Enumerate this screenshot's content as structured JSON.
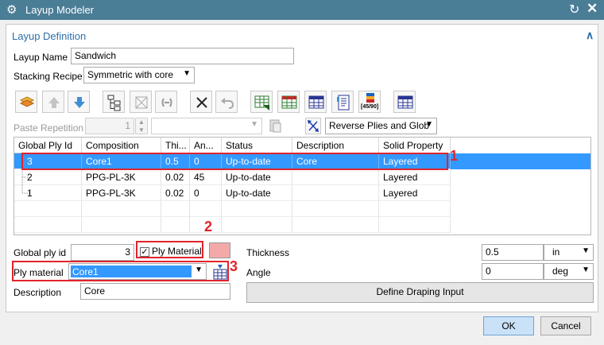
{
  "window": {
    "title": "Layup Modeler"
  },
  "section": {
    "title": "Layup Definition"
  },
  "layup_name": {
    "label": "Layup Name",
    "value": "Sandwich"
  },
  "stacking_recipe": {
    "label": "Stacking Recipe",
    "value": "Symmetric with core"
  },
  "toolbar_icons": [
    "layers-icon",
    "move-up-icon",
    "move-down-icon",
    "tree-icon",
    "delete-all-icon",
    "chain-icon",
    "delete-icon",
    "undo-icon",
    "table-export-icon",
    "table-icon",
    "table-header-icon",
    "document-icon",
    "ply-45-90-icon",
    "table-alt-icon"
  ],
  "ply_badge": "[45/90]",
  "paste_repetition": {
    "label": "Paste Repetition",
    "value": "1",
    "combo_value": ""
  },
  "reverse_plies": {
    "value": "Reverse Plies and Glob"
  },
  "grid": {
    "columns": [
      "Global Ply Id",
      "Composition",
      "Thi...",
      "An...",
      "Status",
      "Description",
      "Solid Property"
    ],
    "rows": [
      {
        "id": "3",
        "composition": "Core1",
        "thickness": "0.5",
        "angle": "0",
        "status": "Up-to-date",
        "description": "Core",
        "solid": "Layered"
      },
      {
        "id": "2",
        "composition": "PPG-PL-3K",
        "thickness": "0.02",
        "angle": "45",
        "status": "Up-to-date",
        "description": "",
        "solid": "Layered"
      },
      {
        "id": "1",
        "composition": "PPG-PL-3K",
        "thickness": "0.02",
        "angle": "0",
        "status": "Up-to-date",
        "description": "",
        "solid": "Layered"
      }
    ]
  },
  "global_ply_id": {
    "label": "Global ply id",
    "value": "3"
  },
  "ply_material_checkbox": {
    "label": "Ply Material",
    "checked": true
  },
  "swatch_color": "#f4a9a9",
  "ply_material": {
    "label": "Ply material",
    "value": "Core1"
  },
  "description": {
    "label": "Description",
    "value": "Core"
  },
  "thickness": {
    "label": "Thickness",
    "value": "0.5",
    "unit": "in"
  },
  "angle": {
    "label": "Angle",
    "value": "0",
    "unit": "deg"
  },
  "define_draping": {
    "label": "Define Draping Input"
  },
  "callouts": [
    "1",
    "2",
    "3"
  ],
  "footer": {
    "ok": "OK",
    "cancel": "Cancel"
  },
  "colors": {
    "title_bar": "#4a7d96",
    "section_title": "#2f6fa7",
    "selection": "#3399ff",
    "callout": "#e0242c"
  }
}
